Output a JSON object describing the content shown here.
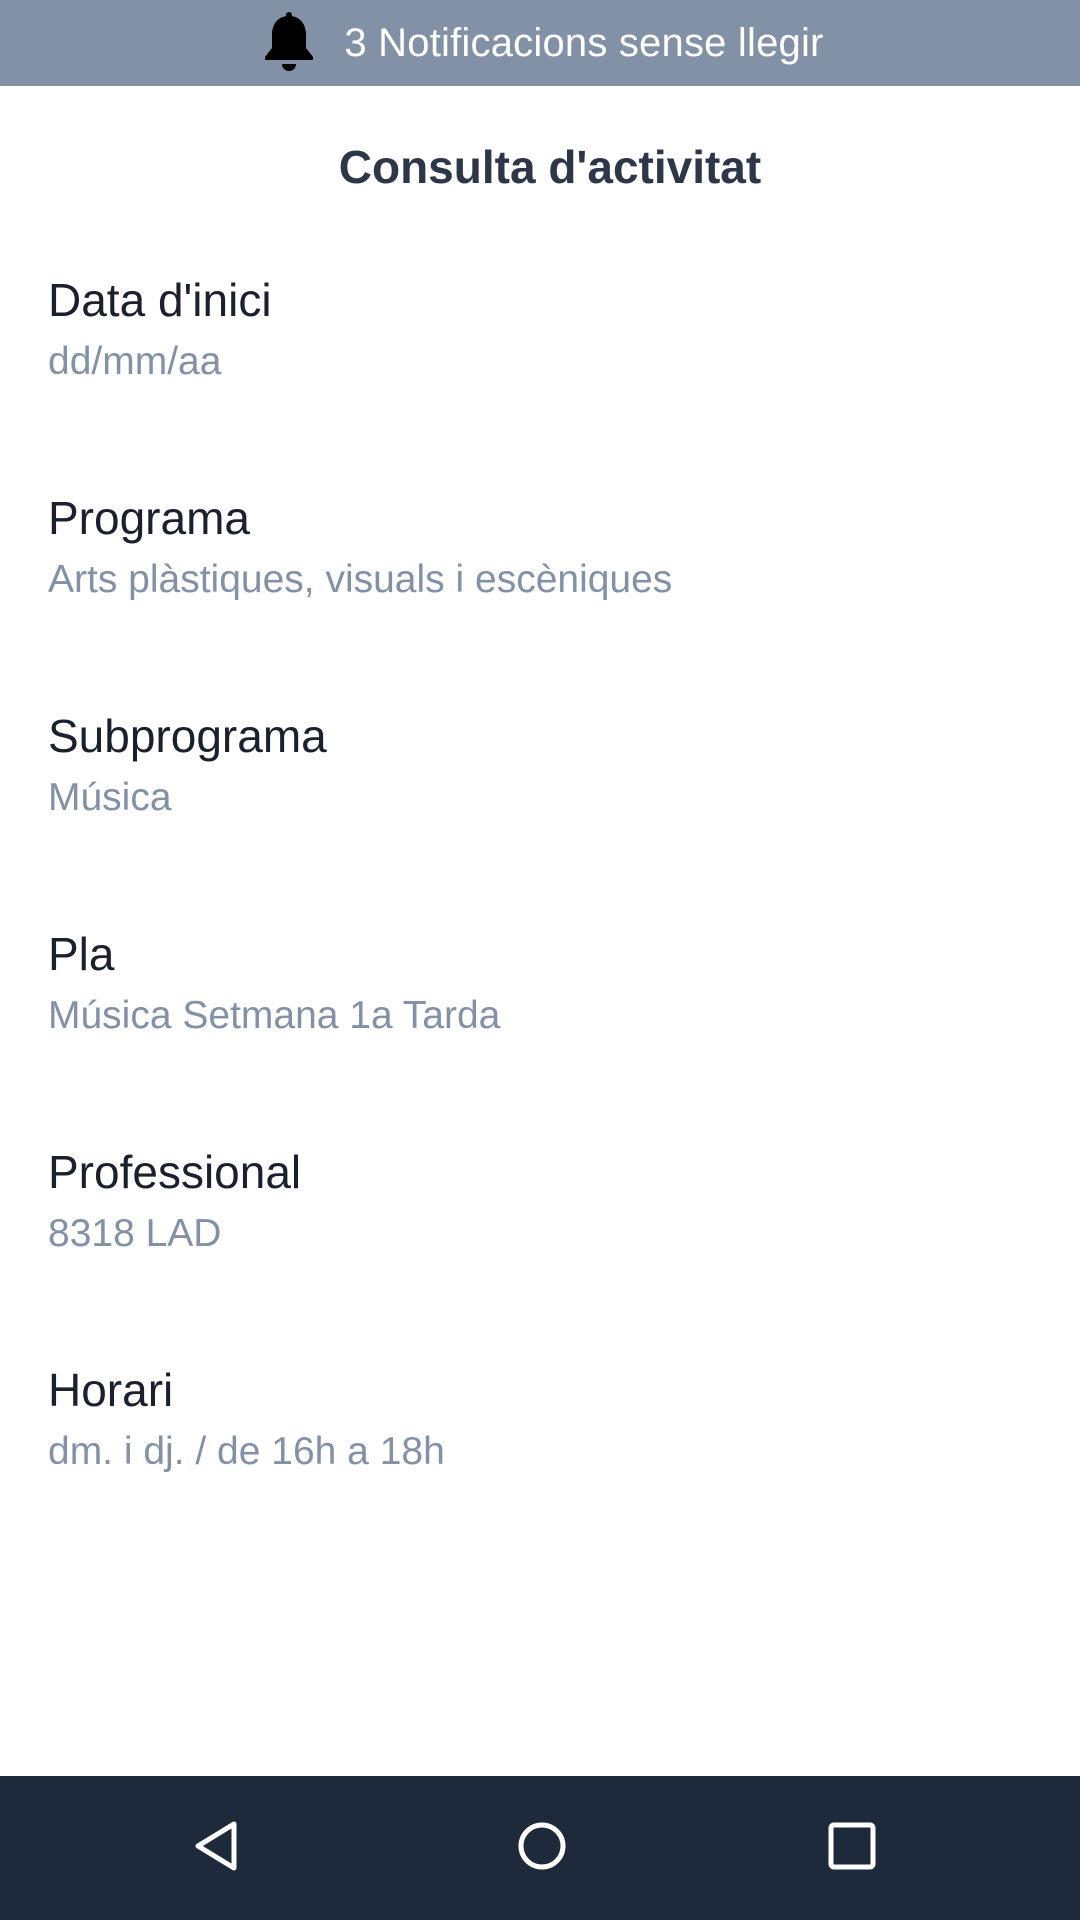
{
  "notification_bar": {
    "icon": "bell-icon",
    "text": "3 Notificacions sense llegir",
    "background": "#8391a7"
  },
  "page": {
    "title": "Consulta d'activitat"
  },
  "fields": [
    {
      "label": "Data d'inici",
      "value": "dd/mm/aa"
    },
    {
      "label": "Programa",
      "value": "Arts plàstiques, visuals i escèniques"
    },
    {
      "label": "Subprograma",
      "value": "Música"
    },
    {
      "label": "Pla",
      "value": "Música Setmana 1a Tarda"
    },
    {
      "label": "Professional",
      "value": "8318 LAD"
    },
    {
      "label": "Horari",
      "value": "dm. i dj. / de 16h a 18h"
    }
  ],
  "nav_bar": {
    "background": "#1e2a3b",
    "buttons": [
      "back-icon",
      "home-icon",
      "recents-icon"
    ]
  },
  "colors": {
    "label": "#1a202c",
    "value": "#8391a7",
    "title": "#2d3748"
  }
}
